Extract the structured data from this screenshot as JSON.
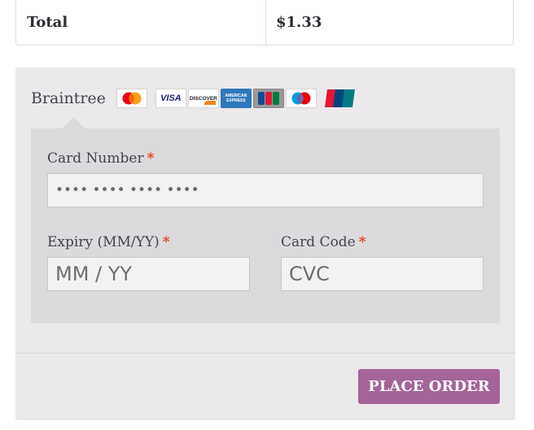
{
  "order": {
    "total_label": "Total",
    "total_value": "$1.33"
  },
  "payment": {
    "method_label": "Braintree",
    "card_icons": [
      {
        "name": "mastercard-icon",
        "text": "MasterCard"
      },
      {
        "name": "visa-icon",
        "text": "VISA"
      },
      {
        "name": "discover-icon",
        "text": "DISCOVER"
      },
      {
        "name": "amex-icon",
        "text": "AMERICAN EXPRESS"
      },
      {
        "name": "jcb-icon",
        "text": "JCB"
      },
      {
        "name": "maestro-icon",
        "text": "Maestro"
      },
      {
        "name": "unionpay-icon",
        "text": "UnionPay"
      }
    ],
    "card_number": {
      "label": "Card Number",
      "required_mark": "*",
      "value": "•••• •••• •••• ••••"
    },
    "expiry": {
      "label": "Expiry (MM/YY)",
      "required_mark": "*",
      "placeholder": "MM / YY"
    },
    "card_code": {
      "label": "Card Code",
      "required_mark": "*",
      "placeholder": "CVC"
    },
    "place_order_label": "PLACE ORDER"
  },
  "colors": {
    "button": "#a46497",
    "required": "#e2401c",
    "panel": "#ebe9eb",
    "inner_panel": "#dcdadc"
  }
}
